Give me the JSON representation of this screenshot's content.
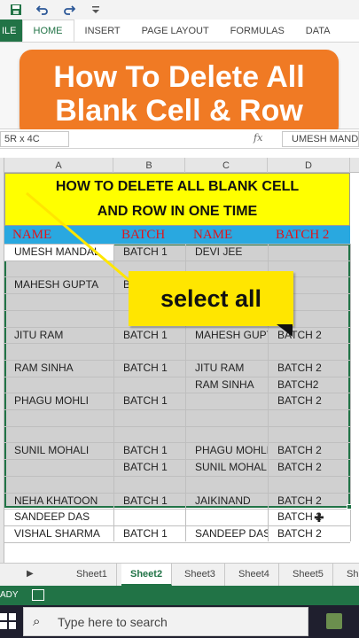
{
  "ribbon": {
    "tabs": [
      "ILE",
      "HOME",
      "INSERT",
      "PAGE LAYOUT",
      "FORMULAS",
      "DATA"
    ],
    "active_tab": "HOME"
  },
  "banner": {
    "line1": "How To Delete All",
    "line2": "Blank Cell & Row"
  },
  "formula_bar": {
    "name_box": "5R x 4C",
    "fx": "fx",
    "content": "UMESH MANDAL"
  },
  "columns": [
    "A",
    "B",
    "C",
    "D"
  ],
  "sheet_heading": {
    "line1": "HOW TO DELETE ALL BLANK CELL",
    "line2": "AND ROW IN ONE TIME"
  },
  "table_headers": [
    "NAME",
    "BATCH",
    "NAME",
    "BATCH 2"
  ],
  "rows": [
    [
      "UMESH MANDAL",
      "BATCH 1",
      "DEVI JEE",
      ""
    ],
    [
      "",
      "",
      "",
      ""
    ],
    [
      "MAHESH GUPTA",
      "B",
      "",
      ""
    ],
    [
      "",
      "",
      "",
      ""
    ],
    [
      "",
      "",
      "",
      ""
    ],
    [
      "JITU RAM",
      "BATCH 1",
      "MAHESH GUPT",
      "BATCH 2"
    ],
    [
      "",
      "",
      "",
      ""
    ],
    [
      "RAM SINHA",
      "BATCH 1",
      "JITU RAM",
      "BATCH 2"
    ],
    [
      "",
      "",
      "RAM SINHA",
      "BATCH2"
    ],
    [
      "PHAGU MOHLI",
      "BATCH 1",
      "",
      "BATCH 2"
    ],
    [
      "",
      "",
      "",
      ""
    ],
    [
      "",
      "",
      "",
      ""
    ],
    [
      "SUNIL MOHALI",
      "BATCH 1",
      "PHAGU MOHLI",
      "BATCH 2"
    ],
    [
      "",
      "BATCH 1",
      "SUNIL MOHALI",
      "BATCH 2"
    ],
    [
      "",
      "",
      "",
      ""
    ],
    [
      "NEHA KHATOON",
      "BATCH 1",
      "JAIKINAND",
      "BATCH 2"
    ],
    [
      "SANDEEP DAS",
      "",
      "",
      "BATCH 2"
    ],
    [
      "VISHAL SHARMA",
      "BATCH 1",
      "SANDEEP DAS",
      "BATCH 2"
    ]
  ],
  "callout": "select all",
  "sheet_tabs": [
    "Sheet1",
    "Sheet2",
    "Sheet3",
    "Sheet4",
    "Sheet5",
    "Sh"
  ],
  "active_sheet": "Sheet2",
  "status": "ADY",
  "taskbar": {
    "search_placeholder": "Type here to search"
  },
  "colors": {
    "excel_green": "#217346",
    "banner_orange": "#f07a24",
    "heading_yellow": "#ffff00",
    "header_blue": "#29a8e0",
    "header_text_red": "#e0151b",
    "callout_yellow": "#ffe600"
  }
}
